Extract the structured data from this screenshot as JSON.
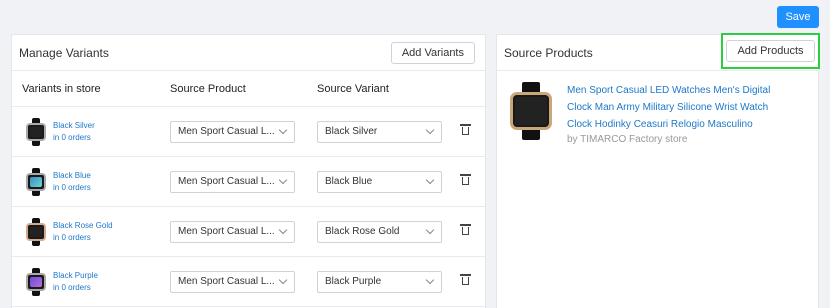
{
  "toolbar": {
    "save_label": "Save"
  },
  "manage": {
    "title": "Manage Variants",
    "add_variants_label": "Add Variants",
    "col_store": "Variants in store",
    "col_source_product": "Source Product",
    "col_source_variant": "Source Variant",
    "rows": [
      {
        "name": "Black Silver",
        "orders": "in 0 orders",
        "product": "Men Sport Casual L...",
        "variant": "Black Silver"
      },
      {
        "name": "Black Blue",
        "orders": "in 0 orders",
        "product": "Men Sport Casual L...",
        "variant": "Black Blue"
      },
      {
        "name": "Black Rose Gold",
        "orders": "in 0 orders",
        "product": "Men Sport Casual L...",
        "variant": "Black Rose Gold"
      },
      {
        "name": "Black Purple",
        "orders": "in 0 orders",
        "product": "Men Sport Casual L...",
        "variant": "Black Purple"
      }
    ]
  },
  "source": {
    "title": "Source Products",
    "add_products_label": "Add Products",
    "product_title": "Men Sport Casual LED Watches Men's Digital Clock Man Army Military Silicone Wrist Watch Clock Hodinky Ceasuri Relogio Masculino",
    "product_store": "by TIMARCO Factory store"
  },
  "colors": {
    "accent": "#1e90ff",
    "link": "#1e78c8",
    "highlight": "#2ecc40"
  }
}
